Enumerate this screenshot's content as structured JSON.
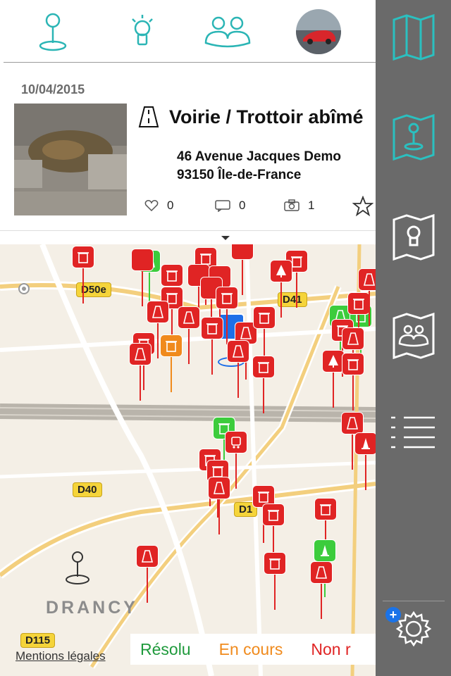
{
  "tabs": [
    {
      "name": "pin-icon"
    },
    {
      "name": "lightbulb-icon"
    },
    {
      "name": "people-icon"
    },
    {
      "name": "avatar-icon"
    }
  ],
  "report": {
    "date": "10/04/2015",
    "title": "Voirie / Trottoir abîmé",
    "address_line1": "46 Avenue Jacques Demo",
    "address_line2": "93150 Île-de-France",
    "likes": "0",
    "comments": "0",
    "photos": "1"
  },
  "map": {
    "road_labels": [
      "D50e",
      "D41",
      "D40",
      "D115",
      "D1"
    ],
    "place_labels": [
      "Drancy"
    ],
    "pins": [
      {
        "color": "red"
      },
      {
        "color": "green"
      },
      {
        "color": "orange"
      }
    ]
  },
  "legend": {
    "resolved": "Résolu",
    "in_progress": "En cours",
    "not_resolved": "Non r",
    "mentions": "Mentions légales"
  },
  "colors": {
    "accent": "#2bb5b5",
    "pin_red": "#e02424",
    "pin_green": "#3ccc3c",
    "pin_orange": "#f08a1c",
    "sidebar": "#6a6a6a"
  }
}
